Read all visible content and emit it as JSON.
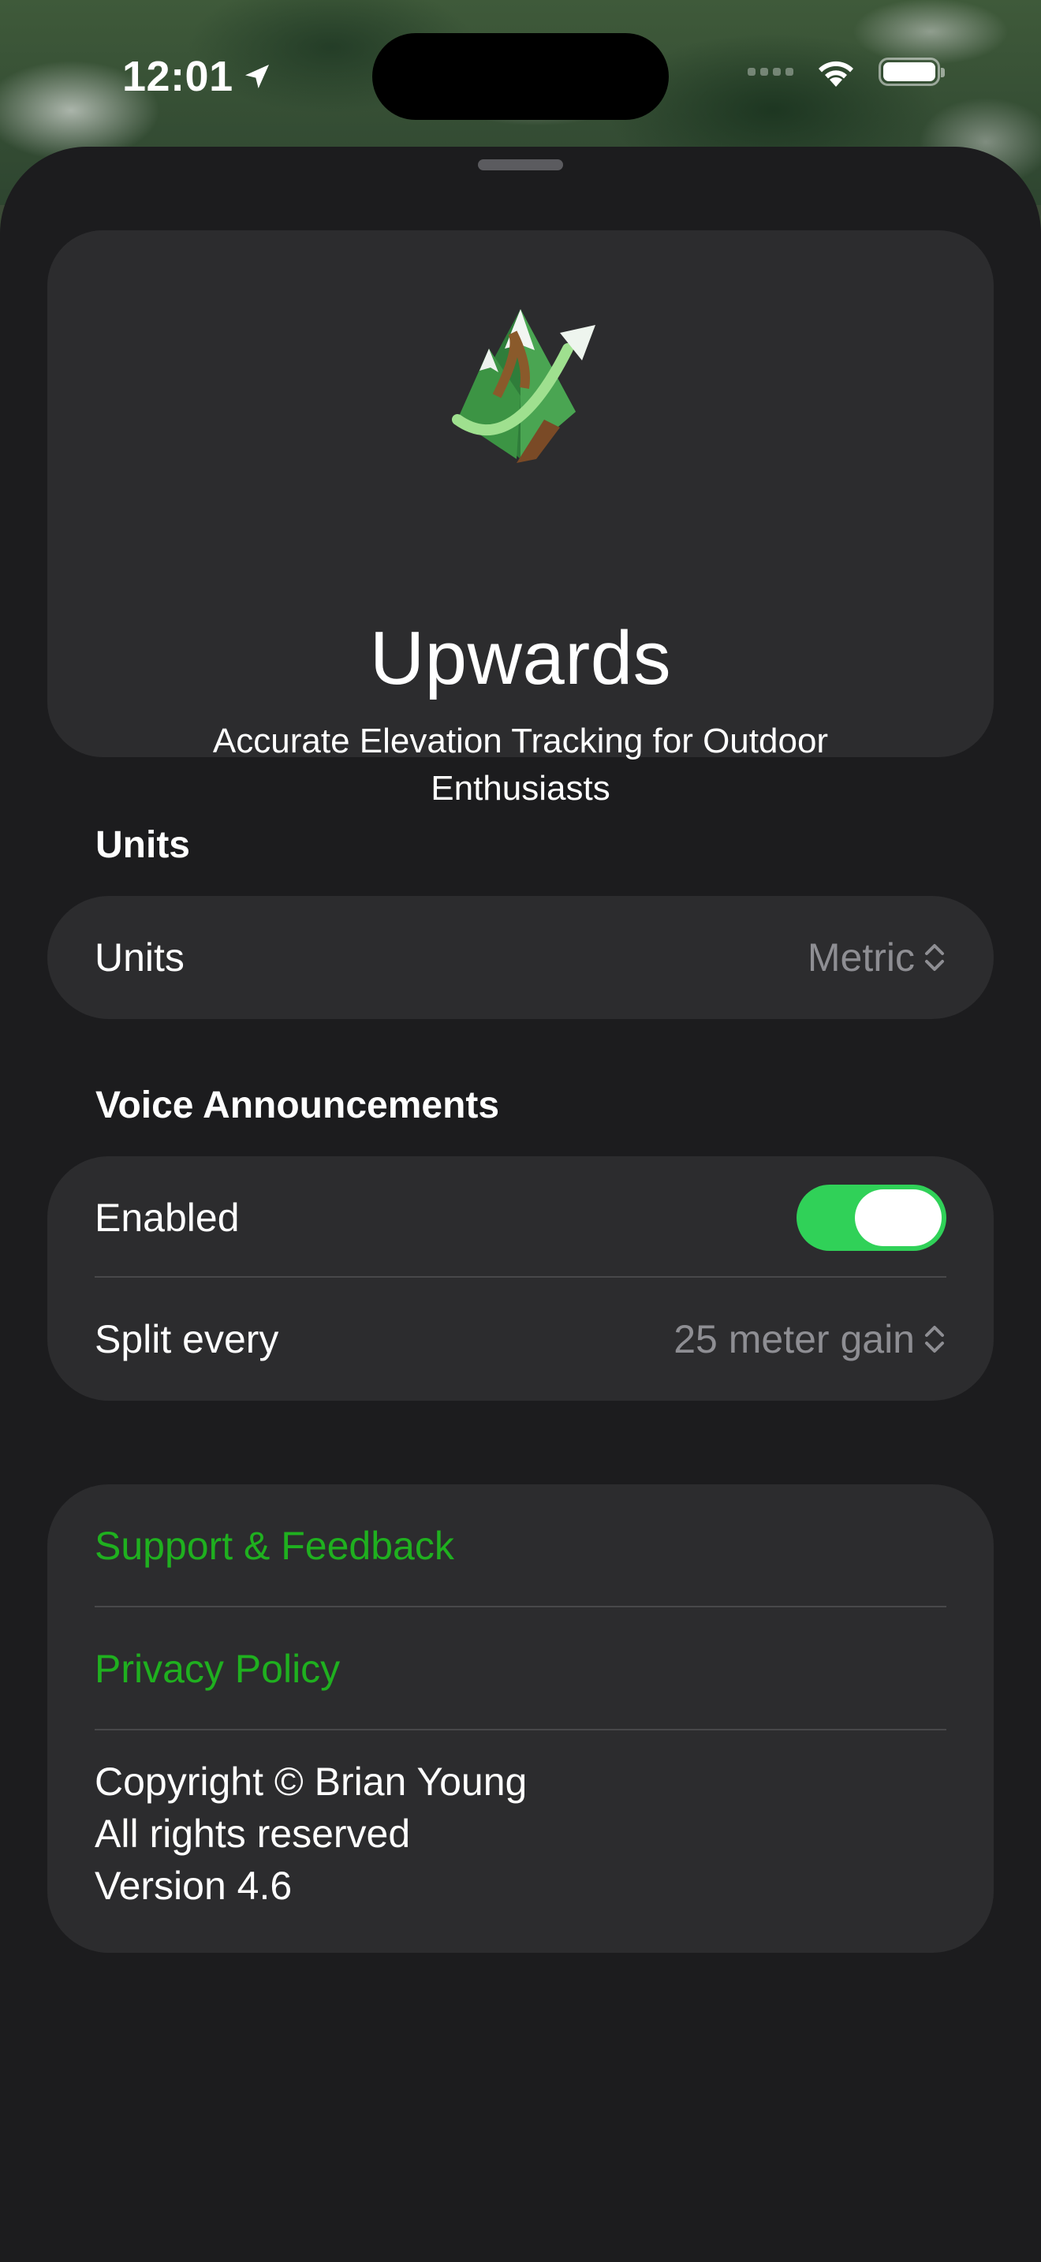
{
  "status_bar": {
    "time": "12:01"
  },
  "header": {
    "app_name": "Upwards",
    "tagline": "Accurate Elevation Tracking for Outdoor Enthusiasts"
  },
  "units_section": {
    "title": "Units",
    "row_label": "Units",
    "row_value": "Metric"
  },
  "voice_section": {
    "title": "Voice Announcements",
    "enabled_label": "Enabled",
    "enabled": true,
    "split_label": "Split every",
    "split_value": "25 meter gain"
  },
  "about_section": {
    "support_label": "Support & Feedback",
    "privacy_label": "Privacy Policy",
    "copyright": "Copyright © Brian Young",
    "rights": "All rights reserved",
    "version": "Version 4.6"
  },
  "colors": {
    "accent_link": "#1fb01f",
    "toggle_on": "#30d158",
    "sheet_bg": "#1c1c1e",
    "card_bg": "#2c2c2e"
  }
}
